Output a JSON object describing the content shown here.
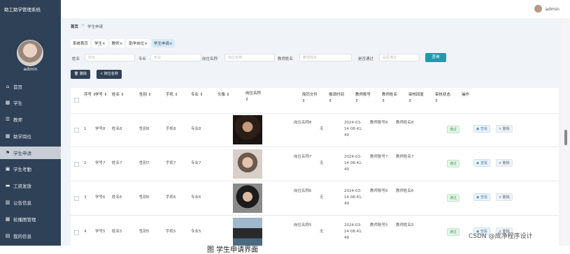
{
  "app": {
    "title": "助工助学管理系统"
  },
  "sidebar": {
    "user": "admin",
    "items": [
      {
        "label": "首页",
        "icon": "home-icon",
        "glyph": "⌂",
        "active": false
      },
      {
        "label": "学生",
        "icon": "grid-icon",
        "glyph": "▦",
        "active": false
      },
      {
        "label": "教师",
        "icon": "list-icon",
        "glyph": "☰",
        "active": false
      },
      {
        "label": "助学岗位",
        "icon": "grid-icon",
        "glyph": "▦",
        "active": false
      },
      {
        "label": "学生申请",
        "icon": "flag-icon",
        "glyph": "⚑",
        "active": true
      },
      {
        "label": "学生考勤",
        "icon": "clipboard-icon",
        "glyph": "▣",
        "active": false
      },
      {
        "label": "工资发放",
        "icon": "chat-icon",
        "glyph": "▬",
        "active": false
      },
      {
        "label": "公告信息",
        "icon": "bars-icon",
        "glyph": "▥",
        "active": false
      },
      {
        "label": "轮播图管理",
        "icon": "grid-icon",
        "glyph": "▦",
        "active": false
      },
      {
        "label": "我的信息",
        "icon": "calendar-icon",
        "glyph": "▤",
        "active": false
      }
    ]
  },
  "topbar": {
    "user": "admin"
  },
  "breadcrumb": {
    "home": "首页",
    "sep": "☰",
    "current": "学生申请"
  },
  "tabs": [
    {
      "label": "系统首页",
      "closable": false,
      "active": false
    },
    {
      "label": "学生",
      "closable": true,
      "active": false
    },
    {
      "label": "教师",
      "closable": true,
      "active": false
    },
    {
      "label": "助学岗位",
      "closable": true,
      "active": false
    },
    {
      "label": "学生申请",
      "closable": true,
      "active": true
    }
  ],
  "close_glyph": "×",
  "search": {
    "fields": [
      {
        "label": "姓名",
        "placeholder": "姓名"
      },
      {
        "label": "专业",
        "placeholder": "专业"
      },
      {
        "label": "岗位名称",
        "placeholder": "岗位名称"
      },
      {
        "label": "教师姓名",
        "placeholder": "教师姓名"
      },
      {
        "label": "是否通过",
        "placeholder": "是否通过"
      }
    ],
    "query_label": "查询"
  },
  "actions": {
    "delete_label": "删除",
    "post_label": "岗位名称"
  },
  "table": {
    "headers": [
      "序号",
      "学号",
      "姓名",
      "性别",
      "手机",
      "专业",
      "头像",
      "岗位名称",
      "简历文件",
      "报请时间",
      "教师账号",
      "教师姓名",
      "审核回复",
      "审核状态",
      "操作"
    ],
    "sort_glyph": "⇕",
    "rows": [
      {
        "no": "1",
        "sid": "学号8",
        "name": "姓名8",
        "gender": "性别8",
        "phone": "手机8",
        "major": "专业8",
        "post": "岗位名称8",
        "resume": "无",
        "time": "2024-03-14 08:41:49",
        "tacct": "教师账号8",
        "tname": "教师姓名8",
        "reply": "",
        "status": "通过"
      },
      {
        "no": "2",
        "sid": "学号7",
        "name": "姓名7",
        "gender": "性别7",
        "phone": "手机7",
        "major": "专业7",
        "post": "岗位名称7",
        "resume": "无",
        "time": "2024-03-14 08:41:49",
        "tacct": "教师账号7",
        "tname": "教师姓名7",
        "reply": "",
        "status": "通过"
      },
      {
        "no": "3",
        "sid": "学号6",
        "name": "姓名6",
        "gender": "性别6",
        "phone": "手机6",
        "major": "专业6",
        "post": "岗位名称6",
        "resume": "无",
        "time": "2024-03-14 08:41:49",
        "tacct": "教师账号6",
        "tname": "教师姓名6",
        "reply": "",
        "status": "通过"
      },
      {
        "no": "4",
        "sid": "学号5",
        "name": "姓名5",
        "gender": "性别5",
        "phone": "手机5",
        "major": "专业5",
        "post": "岗位名称5",
        "resume": "无",
        "time": "2024-03-14 08:41:49",
        "tacct": "教师账号5",
        "tname": "教师姓名5",
        "reply": "",
        "status": "通过"
      }
    ],
    "view_label": "查看",
    "delete_label": "删除"
  },
  "caption": "图     学生申请界面",
  "watermark": "CSDN @成净程序设计",
  "colors": {
    "sidebar": "#2f4156",
    "accent": "#1d9cad",
    "page_bg": "#f0f4f8"
  }
}
